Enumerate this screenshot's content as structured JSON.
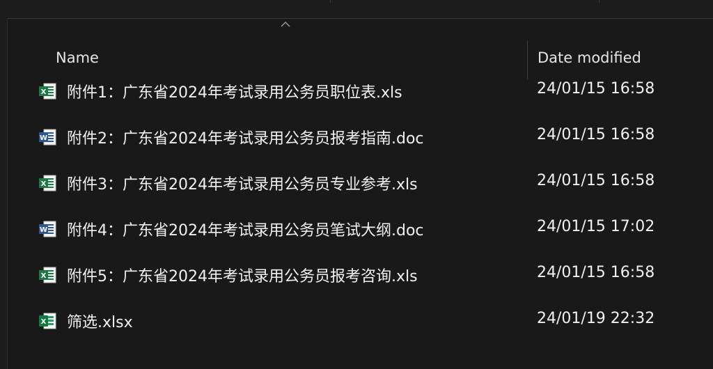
{
  "header": {
    "name_label": "Name",
    "date_label": "Date modified"
  },
  "files": [
    {
      "name": "附件1：广东省2024年考试录用公务员职位表.xls",
      "date": "24/01/15 16:58",
      "icon": "excel-xls-icon"
    },
    {
      "name": "附件2：广东省2024年考试录用公务员报考指南.doc",
      "date": "24/01/15 16:58",
      "icon": "word-doc-icon"
    },
    {
      "name": "附件3：广东省2024年考试录用公务员专业参考.xls",
      "date": "24/01/15 16:58",
      "icon": "excel-xls-icon"
    },
    {
      "name": "附件4：广东省2024年考试录用公务员笔试大纲.doc",
      "date": "24/01/15 17:02",
      "icon": "word-doc-icon"
    },
    {
      "name": "附件5：广东省2024年考试录用公务员报考咨询.xls",
      "date": "24/01/15 16:58",
      "icon": "excel-xls-icon"
    },
    {
      "name": "筛选.xlsx",
      "date": "24/01/19 22:32",
      "icon": "excel-xlsx-icon"
    }
  ],
  "colors": {
    "background": "#191919",
    "excel_green": "#1e7a45",
    "word_blue": "#2b5797"
  }
}
